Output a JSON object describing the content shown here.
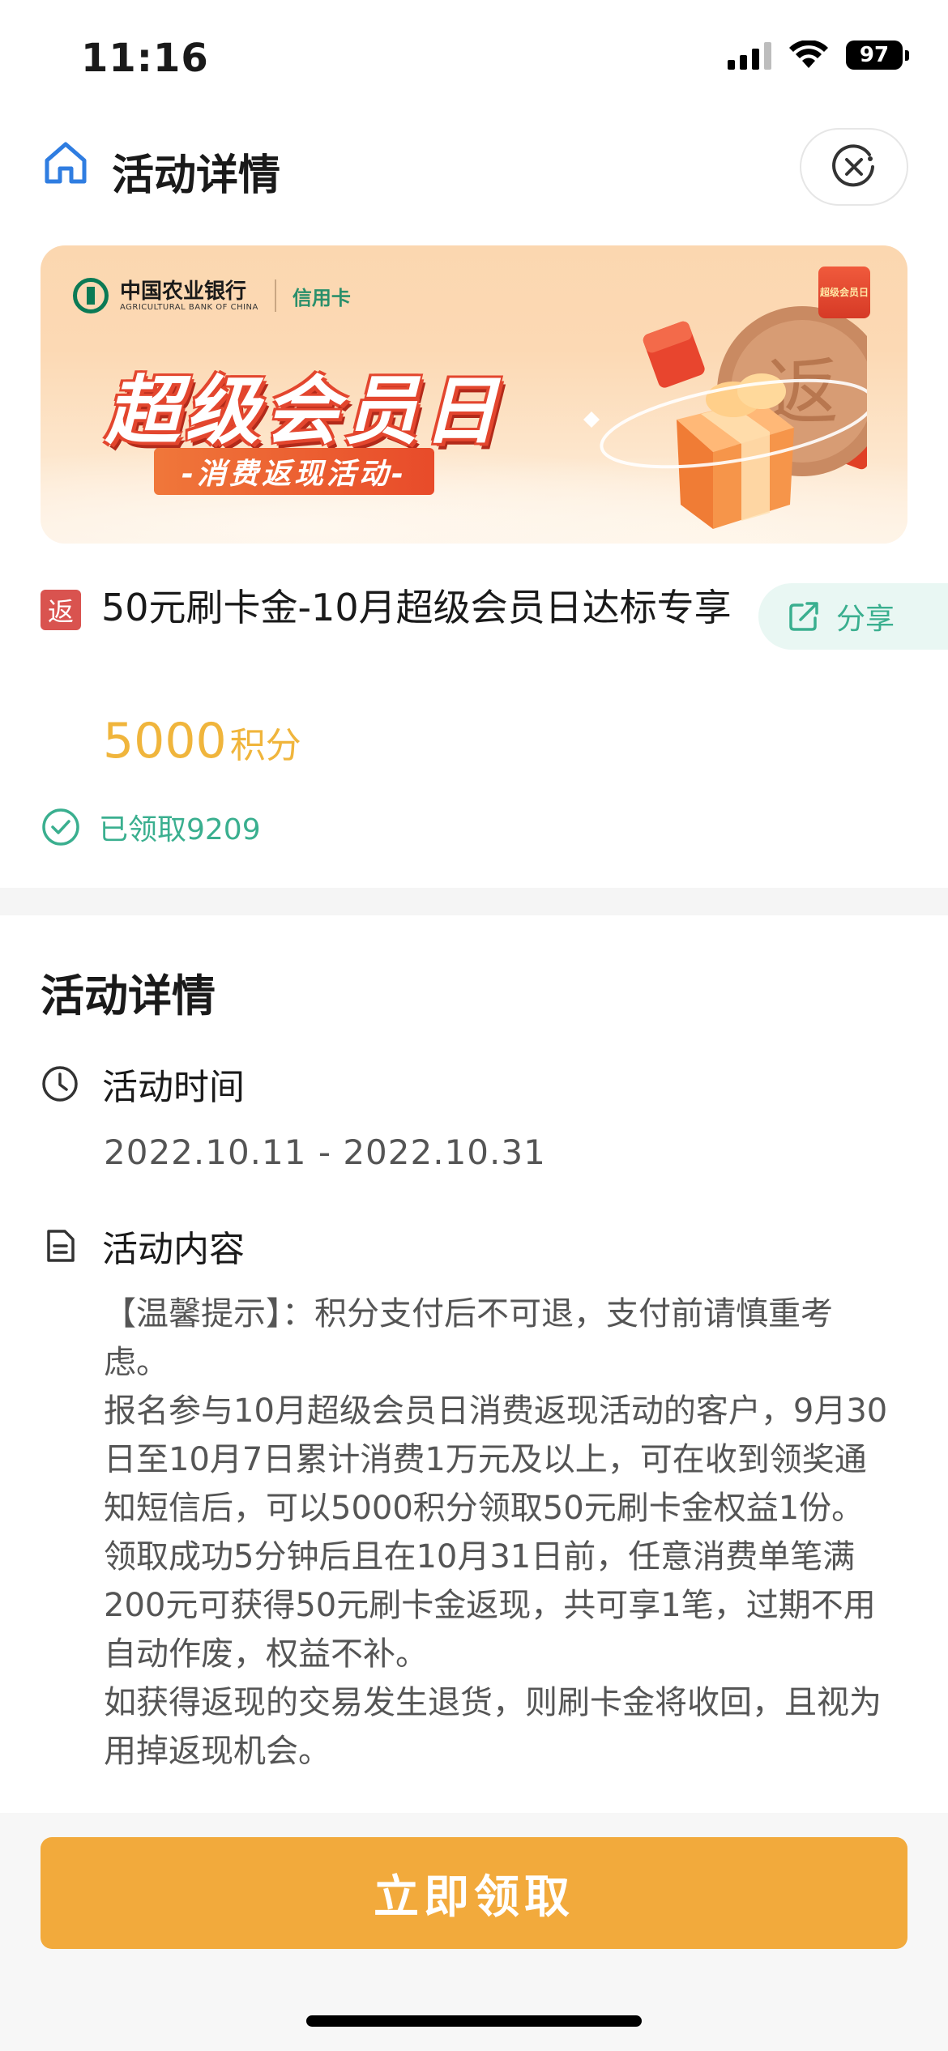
{
  "status_bar": {
    "time": "11:16",
    "battery": "97"
  },
  "header": {
    "title": "活动详情"
  },
  "banner": {
    "bank_name": "中国农业银行",
    "bank_name_en": "AGRICULTURAL BANK OF CHINA",
    "card_label": "信用卡",
    "title": "超级会员日",
    "subtitle": "-消费返现活动-",
    "coin_char": "返",
    "badge_text": "超级会员日"
  },
  "product": {
    "tag": "返",
    "title": "50元刷卡金-10月超级会员日达标专享",
    "price_value": "5000",
    "price_unit": "积分",
    "claimed": "已领取9209",
    "share_label": "分享"
  },
  "details": {
    "heading": "活动详情",
    "time_label": "活动时间",
    "time_value": "2022.10.11 - 2022.10.31",
    "content_label": "活动内容",
    "content_paragraphs": [
      "【温馨提示】：积分支付后不可退，支付前请慎重考虑。",
      "报名参与10月超级会员日消费返现活动的客户，9月30日至10月7日累计消费1万元及以上，可在收到领奖通知短信后，可以5000积分领取50元刷卡金权益1份。",
      "领取成功5分钟后且在10月31日前，任意消费单笔满200元可获得50元刷卡金返现，共可享1笔，过期不用自动作废，权益不补。",
      "如获得返现的交易发生退货，则刷卡金将收回，且视为用掉返现机会。"
    ]
  },
  "footer": {
    "claim_button": "立即领取"
  },
  "colors": {
    "accent_orange": "#f2aa3c",
    "green": "#3aaf8f",
    "price": "#f0b53c",
    "tag_red": "#d9534f"
  }
}
